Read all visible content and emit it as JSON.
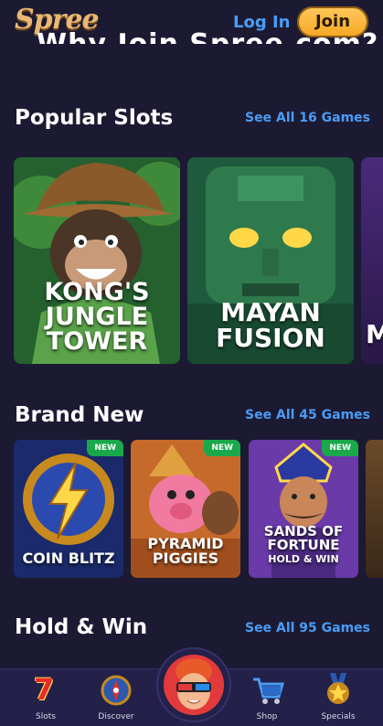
{
  "header": {
    "logo_text": "Spree",
    "login_label": "Log In",
    "join_label": "Join"
  },
  "promo_peek_text": "Why Join Spree.com?",
  "sections": [
    {
      "title": "Popular Slots",
      "see_all": "See All 16 Games",
      "games": [
        {
          "title_lines": [
            "KONG'S",
            "JUNGLE",
            "TOWER"
          ]
        },
        {
          "title_lines": [
            "MAYAN",
            "FUSION"
          ]
        },
        {
          "title_lines": [
            "M"
          ]
        }
      ]
    },
    {
      "title": "Brand New",
      "see_all": "See All 45 Games",
      "games": [
        {
          "title_lines": [
            "COIN BLITZ"
          ],
          "badge": "NEW"
        },
        {
          "title_lines": [
            "PYRAMID",
            "PIGGIES"
          ],
          "badge": "NEW"
        },
        {
          "title_lines": [
            "SANDS OF",
            "FORTUNE",
            "HOLD & WIN"
          ],
          "badge": "NEW"
        }
      ]
    },
    {
      "title": "Hold & Win",
      "see_all": "See All 95 Games"
    }
  ],
  "bottom_nav": [
    {
      "label": "Slots",
      "icon": "lucky-seven-icon"
    },
    {
      "label": "Discover",
      "icon": "compass-icon"
    },
    {
      "label": "",
      "icon": "avatar-3d-glasses"
    },
    {
      "label": "Shop",
      "icon": "shopping-cart-icon"
    },
    {
      "label": "Specials",
      "icon": "star-medal-icon"
    }
  ],
  "colors": {
    "background": "#1c1a33",
    "link_blue": "#4a9cf5",
    "join_gold": "#f5a623",
    "new_badge_green": "#1aa84a",
    "nav_bg": "#23214a"
  }
}
